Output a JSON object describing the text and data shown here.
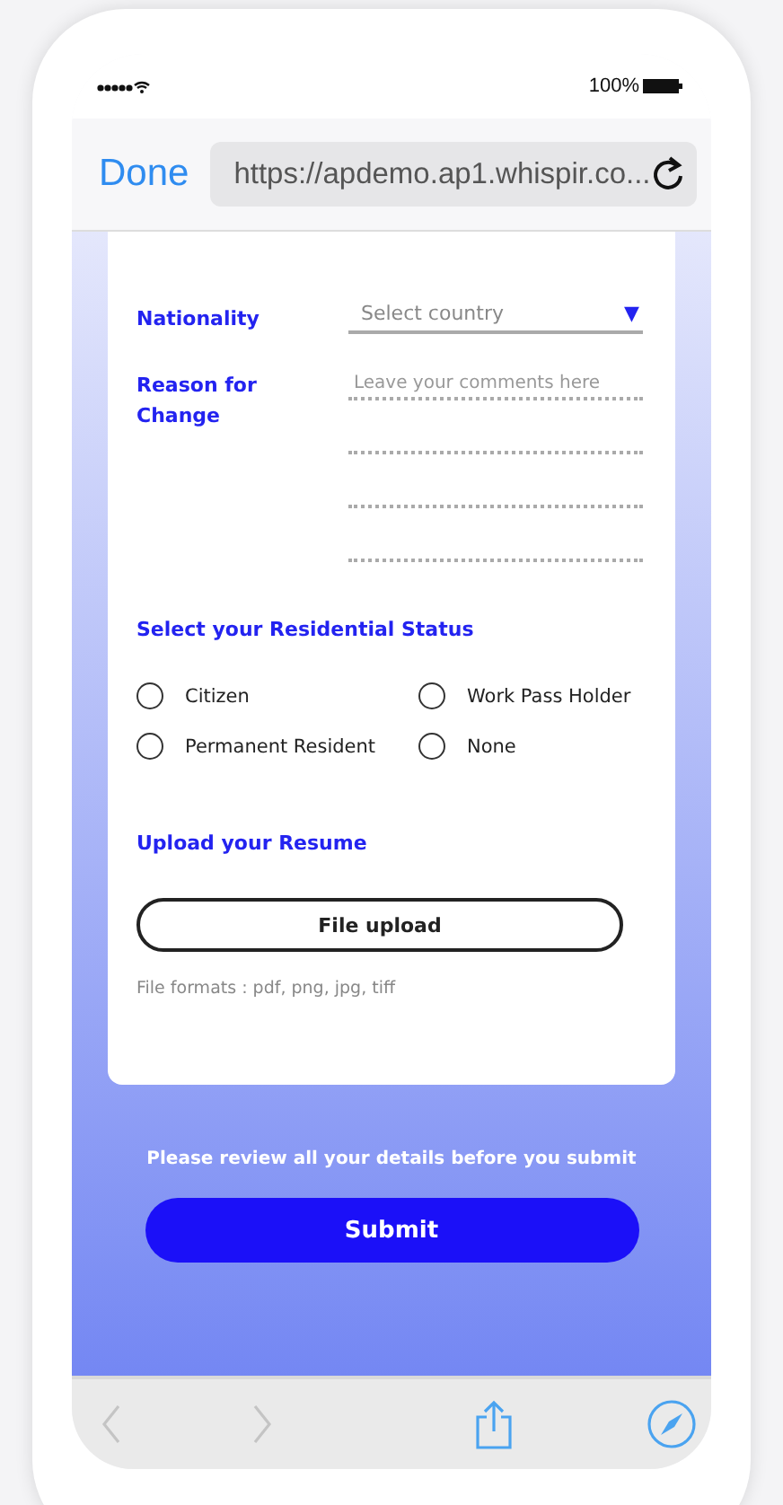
{
  "status_bar": {
    "battery": "100%"
  },
  "browser": {
    "done": "Done",
    "url": "https://apdemo.ap1.whispir.co..."
  },
  "form": {
    "nationality": {
      "label": "Nationality",
      "placeholder": "Select country",
      "arrow": "▼"
    },
    "reason": {
      "label": "Reason for Change",
      "placeholder": "Leave your comments here"
    },
    "status_title": "Select your Residential Status",
    "statuses": [
      {
        "label": "Citizen",
        "selected": false
      },
      {
        "label": "Work Pass Holder",
        "selected": false
      },
      {
        "label": "Permanent Resident",
        "selected": false
      },
      {
        "label": "None",
        "selected": false
      }
    ],
    "upload_title": "Upload your Resume",
    "upload_button": "File upload",
    "formats": "File formats : pdf, png, jpg, tiff"
  },
  "note": "Please review all your details before you submit",
  "submit": "Submit"
}
